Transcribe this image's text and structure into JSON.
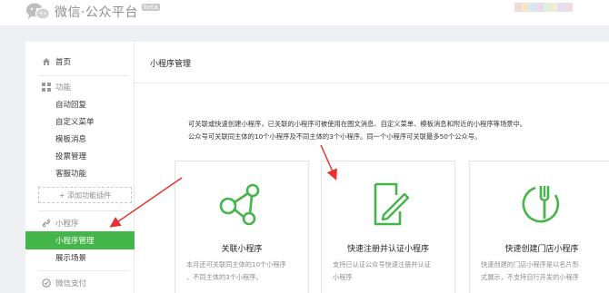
{
  "header": {
    "title": "微信·公众平台",
    "beta": "beta"
  },
  "sidebar": {
    "home": "首页",
    "features_group": "功能",
    "features": [
      "自动回复",
      "自定义菜单",
      "模板消息",
      "投票管理",
      "客服功能"
    ],
    "add_plugin": "+ 添加功能插件",
    "miniprogram_group": "小程序",
    "miniprogram_manage": "小程序管理",
    "showcase": "展示场景",
    "wechat_pay": "微信支付"
  },
  "main": {
    "title": "小程序管理",
    "description": [
      "可关联或快速创建小程序，已关联的小程序可被使用在图文消息、自定义菜单、模板消息和附近的小程序等场景中。",
      "公众号可关联同主体的10个小程序及不同主体的3个小程序。同一个小程序可关联最多50个公众号。"
    ],
    "cards": [
      {
        "title": "关联小程序",
        "desc": [
          "本月还可关联同主体的10个小程序",
          "，不同主体的3个小程序。"
        ]
      },
      {
        "title": "快速注册并认证小程序",
        "desc": [
          "支持已认证公众号快速注册并认证",
          "小程序"
        ]
      },
      {
        "title": "快速创建门店小程序",
        "desc": [
          "快速创建的门店小程序是以名片形",
          "式展示，不支持自行开发的小程序"
        ]
      }
    ]
  },
  "colors": {
    "accent": "#44b549",
    "annotation": "#e8312f"
  }
}
